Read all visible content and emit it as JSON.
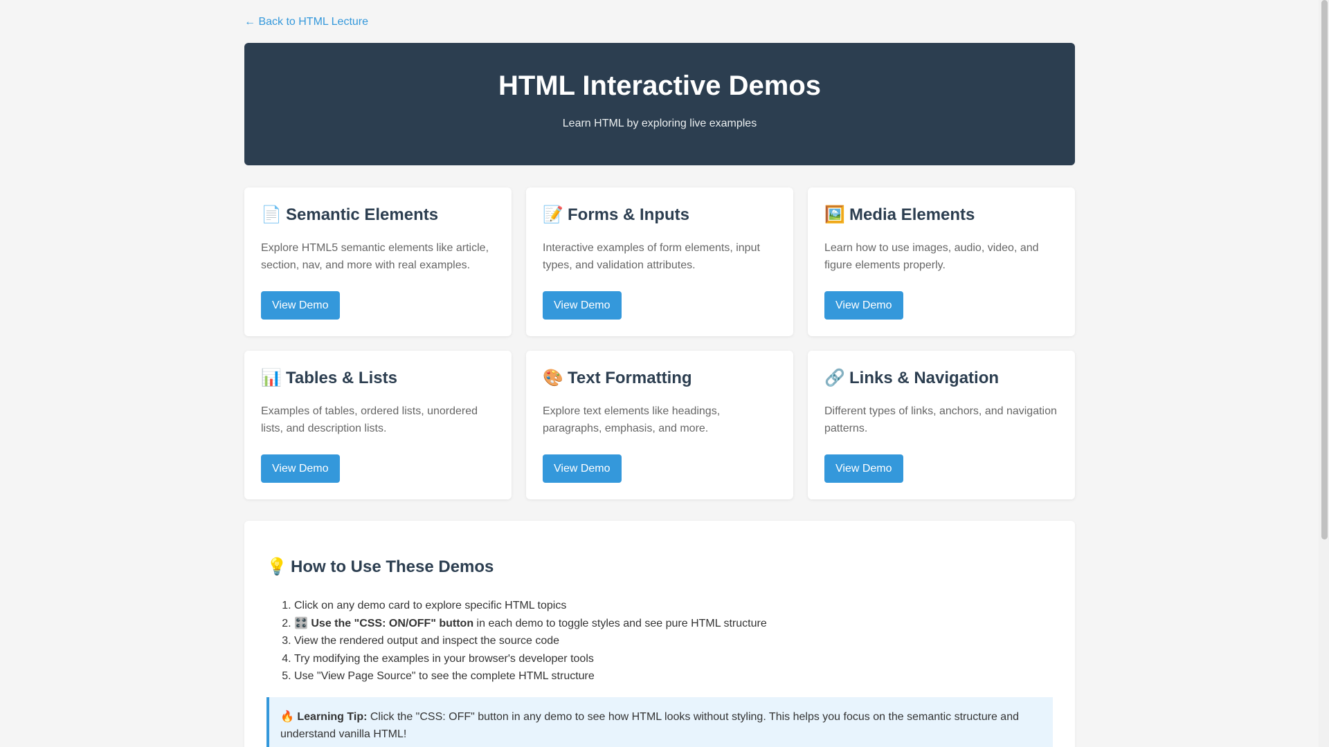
{
  "nav": {
    "back_link": "← Back to HTML Lecture"
  },
  "hero": {
    "title": "HTML Interactive Demos",
    "subtitle": "Learn HTML by exploring live examples"
  },
  "cards": [
    {
      "icon": "📄",
      "icon_name": "document-icon",
      "title": "Semantic Elements",
      "description": "Explore HTML5 semantic elements like article, section, nav, and more with real examples.",
      "button": "View Demo"
    },
    {
      "icon": "📝",
      "icon_name": "memo-icon",
      "title": "Forms & Inputs",
      "description": "Interactive examples of form elements, input types, and validation attributes.",
      "button": "View Demo"
    },
    {
      "icon": "🖼️",
      "icon_name": "picture-icon",
      "title": "Media Elements",
      "description": "Learn how to use images, audio, video, and figure elements properly.",
      "button": "View Demo"
    },
    {
      "icon": "📊",
      "icon_name": "bar-chart-icon",
      "title": "Tables & Lists",
      "description": "Examples of tables, ordered lists, unordered lists, and description lists.",
      "button": "View Demo"
    },
    {
      "icon": "🎨",
      "icon_name": "palette-icon",
      "title": "Text Formatting",
      "description": "Explore text elements like headings, paragraphs, emphasis, and more.",
      "button": "View Demo"
    },
    {
      "icon": "🔗",
      "icon_name": "link-icon",
      "title": "Links & Navigation",
      "description": "Different types of links, anchors, and navigation patterns.",
      "button": "View Demo"
    }
  ],
  "howto": {
    "icon": "💡",
    "icon_name": "light-bulb-icon",
    "title": "How to Use These Demos",
    "steps": [
      {
        "text": "Click on any demo card to explore specific HTML topics"
      },
      {
        "icon": "🎛️",
        "icon_name": "control-knobs-icon",
        "bold": "Use the \"CSS: ON/OFF\" button",
        "text": " in each demo to toggle styles and see pure HTML structure"
      },
      {
        "text": "View the rendered output and inspect the source code"
      },
      {
        "text": "Try modifying the examples in your browser's developer tools"
      },
      {
        "text": "Use \"View Page Source\" to see the complete HTML structure"
      }
    ],
    "tip": {
      "icon": "🔥",
      "icon_name": "fire-icon",
      "label": "Learning Tip:",
      "text": " Click the \"CSS: OFF\" button in any demo to see how HTML looks without styling. This helps you focus on the semantic structure and understand vanilla HTML!"
    }
  },
  "colors": {
    "background": "#f5f5f5",
    "hero_bg": "#2c3e50",
    "accent": "#3498db",
    "tip_bg": "#e8f4fd",
    "card_bg": "#ffffff"
  }
}
